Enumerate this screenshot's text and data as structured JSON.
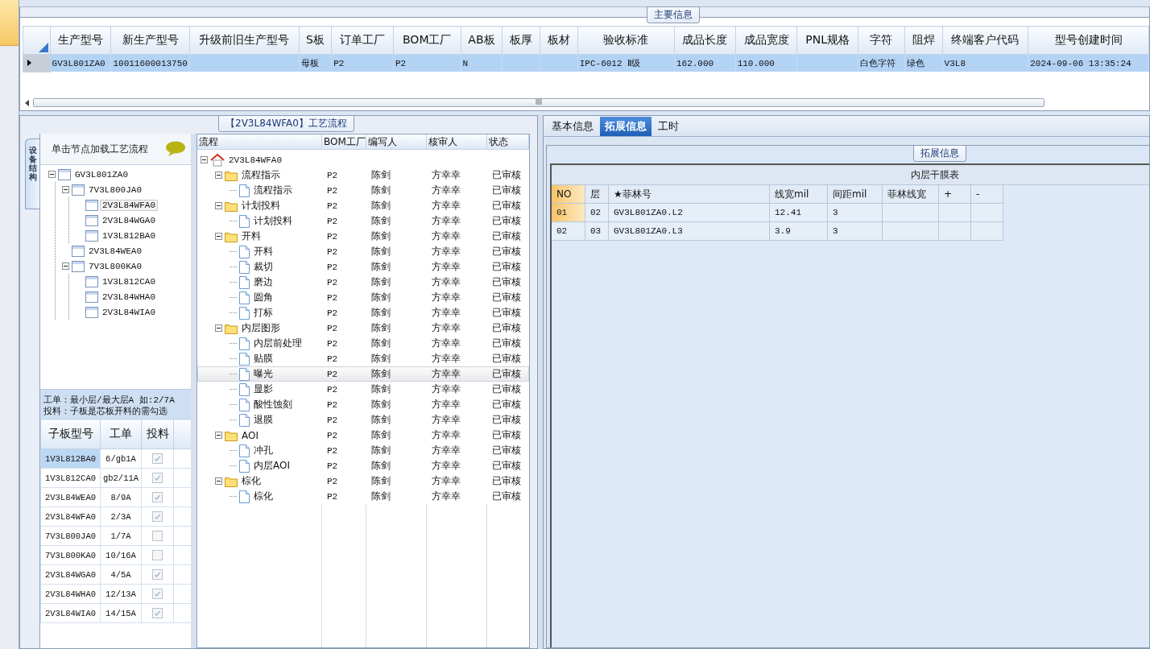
{
  "main_info": {
    "group_title": "主要信息",
    "columns": [
      "生产型号",
      "新生产型号",
      "升级前旧生产型号",
      "S板",
      "订单工厂",
      "BOM工厂",
      "AB板",
      "板厚",
      "板材",
      "验收标准",
      "成品长度",
      "成品宽度",
      "PNL规格",
      "字符",
      "阻焊",
      "终端客户代码",
      "型号创建时间"
    ],
    "rows": [
      {
        "selected": true,
        "cells": [
          "GV3L801ZA0",
          "10011600013750",
          null,
          "母板",
          "P2",
          "P2",
          "N",
          null,
          null,
          "IPC-6012 Ⅱ级",
          "162.000",
          "110.000",
          null,
          "白色字符",
          "绿色",
          "V3L8",
          "2024-09-06 13:35:24"
        ]
      }
    ]
  },
  "process_panel": {
    "title": "【2V3L84WFA0】工艺流程",
    "side_tab": "设备结构",
    "structure_tree": {
      "header": "单击节点加载工艺流程",
      "nodes": [
        {
          "label": "GV3L801ZA0",
          "selected": false,
          "expanded": true,
          "children": [
            {
              "label": "7V3L800JA0",
              "selected": false,
              "expanded": true,
              "children": [
                {
                  "label": "2V3L84WFA0",
                  "selected": true
                },
                {
                  "label": "2V3L84WGA0",
                  "selected": false
                },
                {
                  "label": "1V3L812BA0",
                  "selected": false
                }
              ]
            },
            {
              "label": "2V3L84WEA0",
              "selected": false
            },
            {
              "label": "7V3L800KA0",
              "selected": false,
              "expanded": true,
              "children": [
                {
                  "label": "1V3L812CA0",
                  "selected": false
                },
                {
                  "label": "2V3L84WHA0",
                  "selected": false
                },
                {
                  "label": "2V3L84WIA0",
                  "selected": false
                }
              ]
            }
          ]
        }
      ]
    },
    "note": [
      "工单：最小层/最大层A 如:2/7A",
      "投料：子板是芯板开料的需勾选"
    ],
    "sub_boards": {
      "columns": [
        "子板型号",
        "工单",
        "投料"
      ],
      "rows": [
        {
          "model": "1V3L812BA0",
          "order": "6/gb1A",
          "feed": true,
          "selected": true
        },
        {
          "model": "1V3L812CA0",
          "order": "gb2/11A",
          "feed": true,
          "selected": false
        },
        {
          "model": "2V3L84WEA0",
          "order": "8/9A",
          "feed": true,
          "selected": false
        },
        {
          "model": "2V3L84WFA0",
          "order": "2/3A",
          "feed": true,
          "selected": false
        },
        {
          "model": "7V3L800JA0",
          "order": "1/7A",
          "feed": false,
          "selected": false
        },
        {
          "model": "7V3L800KA0",
          "order": "10/16A",
          "feed": false,
          "selected": false
        },
        {
          "model": "2V3L84WGA0",
          "order": "4/5A",
          "feed": true,
          "selected": false
        },
        {
          "model": "2V3L84WHA0",
          "order": "12/13A",
          "feed": true,
          "selected": false
        },
        {
          "model": "2V3L84WIA0",
          "order": "14/15A",
          "feed": true,
          "selected": false
        }
      ]
    },
    "flow_tree": {
      "columns": [
        "流程",
        "BOM工厂",
        "编写人",
        "核审人",
        "状态"
      ],
      "root": {
        "kind": "root",
        "label": "2V3L84WFA0",
        "expanded": true,
        "children": [
          {
            "kind": "folder",
            "label": "流程指示",
            "bom": "P2",
            "writer": "陈剑",
            "reviewer": "方幸幸",
            "status": "已审核",
            "selected": false,
            "expanded": true,
            "children": [
              {
                "kind": "step",
                "label": "流程指示",
                "bom": "P2",
                "writer": "陈剑",
                "reviewer": "方幸幸",
                "status": "已审核",
                "selected": false
              }
            ]
          },
          {
            "kind": "folder",
            "label": "计划投料",
            "bom": "P2",
            "writer": "陈剑",
            "reviewer": "方幸幸",
            "status": "已审核",
            "selected": false,
            "expanded": true,
            "children": [
              {
                "kind": "step",
                "label": "计划投料",
                "bom": "P2",
                "writer": "陈剑",
                "reviewer": "方幸幸",
                "status": "已审核",
                "selected": false
              }
            ]
          },
          {
            "kind": "folder",
            "label": "开料",
            "bom": "P2",
            "writer": "陈剑",
            "reviewer": "方幸幸",
            "status": "已审核",
            "selected": false,
            "expanded": true,
            "children": [
              {
                "kind": "step",
                "label": "开料",
                "bom": "P2",
                "writer": "陈剑",
                "reviewer": "方幸幸",
                "status": "已审核",
                "selected": false
              },
              {
                "kind": "step",
                "label": "裁切",
                "bom": "P2",
                "writer": "陈剑",
                "reviewer": "方幸幸",
                "status": "已审核",
                "selected": false
              },
              {
                "kind": "step",
                "label": "磨边",
                "bom": "P2",
                "writer": "陈剑",
                "reviewer": "方幸幸",
                "status": "已审核",
                "selected": false
              },
              {
                "kind": "step",
                "label": "圆角",
                "bom": "P2",
                "writer": "陈剑",
                "reviewer": "方幸幸",
                "status": "已审核",
                "selected": false
              },
              {
                "kind": "step",
                "label": "打标",
                "bom": "P2",
                "writer": "陈剑",
                "reviewer": "方幸幸",
                "status": "已审核",
                "selected": false
              }
            ]
          },
          {
            "kind": "folder",
            "label": "内层图形",
            "bom": "P2",
            "writer": "陈剑",
            "reviewer": "方幸幸",
            "status": "已审核",
            "selected": false,
            "expanded": true,
            "children": [
              {
                "kind": "step",
                "label": "内层前处理",
                "bom": "P2",
                "writer": "陈剑",
                "reviewer": "方幸幸",
                "status": "已审核",
                "selected": false
              },
              {
                "kind": "step",
                "label": "贴膜",
                "bom": "P2",
                "writer": "陈剑",
                "reviewer": "方幸幸",
                "status": "已审核",
                "selected": false
              },
              {
                "kind": "step",
                "label": "曝光",
                "bom": "P2",
                "writer": "陈剑",
                "reviewer": "方幸幸",
                "status": "已审核",
                "selected": true
              },
              {
                "kind": "step",
                "label": "显影",
                "bom": "P2",
                "writer": "陈剑",
                "reviewer": "方幸幸",
                "status": "已审核",
                "selected": false
              },
              {
                "kind": "step",
                "label": "酸性蚀刻",
                "bom": "P2",
                "writer": "陈剑",
                "reviewer": "方幸幸",
                "status": "已审核",
                "selected": false
              },
              {
                "kind": "step",
                "label": "退膜",
                "bom": "P2",
                "writer": "陈剑",
                "reviewer": "方幸幸",
                "status": "已审核",
                "selected": false
              }
            ]
          },
          {
            "kind": "folder",
            "label": "AOI",
            "bom": "P2",
            "writer": "陈剑",
            "reviewer": "方幸幸",
            "status": "已审核",
            "selected": false,
            "expanded": true,
            "children": [
              {
                "kind": "step",
                "label": "冲孔",
                "bom": "P2",
                "writer": "陈剑",
                "reviewer": "方幸幸",
                "status": "已审核",
                "selected": false
              },
              {
                "kind": "step",
                "label": "内层AOI",
                "bom": "P2",
                "writer": "陈剑",
                "reviewer": "方幸幸",
                "status": "已审核",
                "selected": false
              }
            ]
          },
          {
            "kind": "folder",
            "label": "棕化",
            "bom": "P2",
            "writer": "陈剑",
            "reviewer": "方幸幸",
            "status": "已审核",
            "selected": false,
            "expanded": true,
            "children": [
              {
                "kind": "step",
                "label": "棕化",
                "bom": "P2",
                "writer": "陈剑",
                "reviewer": "方幸幸",
                "status": "已审核",
                "selected": false
              }
            ]
          }
        ]
      }
    }
  },
  "detail_panel": {
    "tabs": [
      {
        "label": "基本信息",
        "selected": false
      },
      {
        "label": "拓展信息",
        "selected": true
      },
      {
        "label": "工时",
        "selected": false
      }
    ],
    "group_title": "拓展信息",
    "table": {
      "title": "内层干膜表",
      "columns": [
        "NO",
        "层",
        "★菲林号",
        "线宽mil",
        "间距mil",
        "菲林线宽",
        "+",
        "-"
      ],
      "rows": [
        {
          "selected": true,
          "cells": [
            "01",
            "02",
            "GV3L801ZA0.L2",
            "12.41",
            "3",
            null,
            null,
            null
          ]
        },
        {
          "selected": false,
          "cells": [
            "02",
            "03",
            "GV3L801ZA0.L3",
            "3.9",
            "3",
            null,
            null,
            null
          ]
        }
      ]
    }
  }
}
